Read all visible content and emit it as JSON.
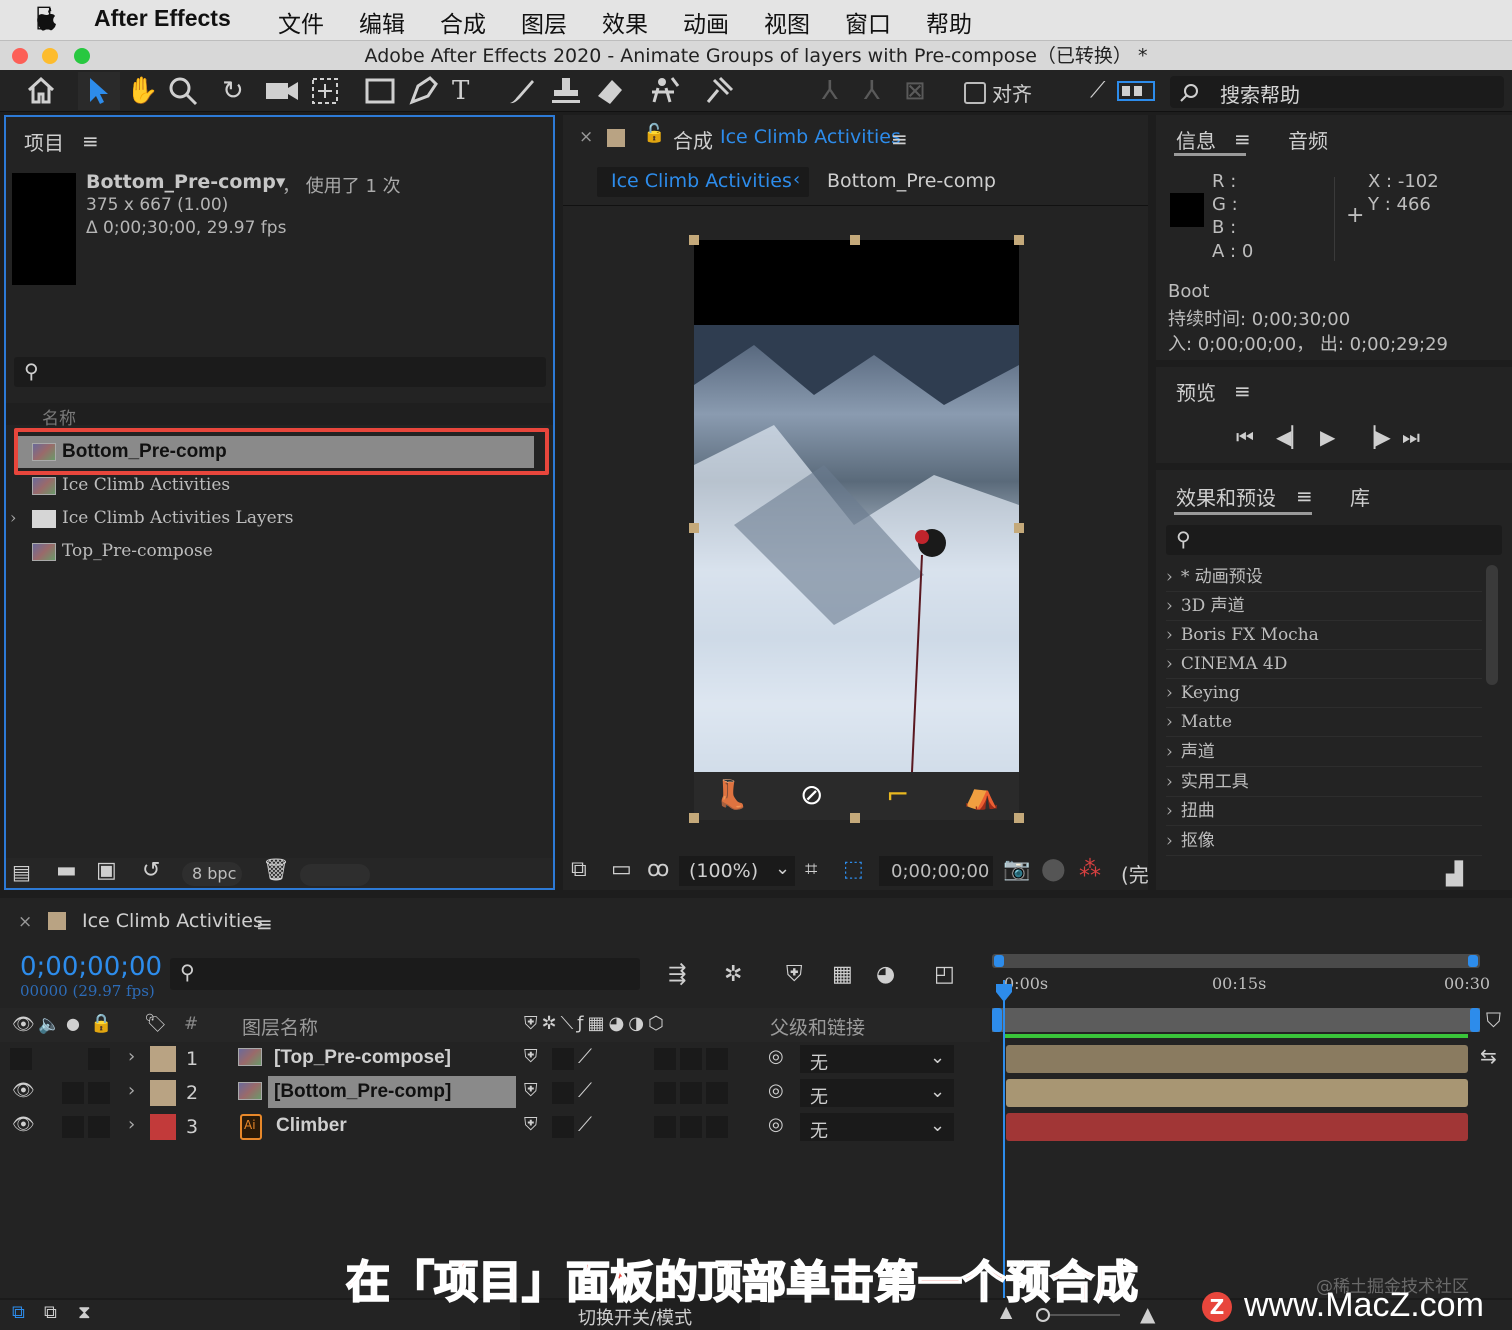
{
  "menubar": {
    "apple": "",
    "app_name": "After Effects",
    "items": [
      "文件",
      "编辑",
      "合成",
      "图层",
      "效果",
      "动画",
      "视图",
      "窗口",
      "帮助"
    ]
  },
  "window": {
    "title": "Adobe After Effects 2020 - Animate Groups of layers with Pre-compose（已转换） *"
  },
  "toolbar": {
    "align_label": "对齐",
    "search_help": "搜索帮助"
  },
  "project_panel": {
    "title": "项目",
    "selected_name": "Bottom_Pre-comp▾",
    "used_count": "，  使用了 1 次",
    "dimensions": "375 x 667 (1.00)",
    "duration": "Δ 0;00;30;00, 29.97 fps",
    "column_name": "名称",
    "items": [
      {
        "name": "Bottom_Pre-comp",
        "type": "comp",
        "selected": true
      },
      {
        "name": "Ice Climb Activities",
        "type": "comp"
      },
      {
        "name": "Ice Climb Activities Layers",
        "type": "folder"
      },
      {
        "name": "Top_Pre-compose",
        "type": "comp"
      }
    ],
    "bpc": "8 bpc"
  },
  "comp_panel": {
    "title_prefix": "合成",
    "title_name": "Ice Climb Activities",
    "tab_active": "Ice Climb Activities",
    "tab_other": "Bottom_Pre-comp",
    "zoom": "(100%)",
    "timecode": "0;00;00;00",
    "quality": "(完"
  },
  "info_panel": {
    "tab_info": "信息",
    "tab_audio": "音频",
    "r": "R :",
    "g": "G :",
    "b": "B :",
    "a": "A :  0",
    "x": "X : -102",
    "y": "Y :  466",
    "layer_name": "Boot",
    "duration": "持续时间: 0;00;30;00",
    "in_out": "入: 0;00;00;00，  出: 0;00;29;29"
  },
  "preview_panel": {
    "title": "预览"
  },
  "effects_panel": {
    "title": "效果和预设",
    "tab_library": "库",
    "items": [
      "* 动画预设",
      "3D 声道",
      "Boris FX Mocha",
      "CINEMA 4D",
      "Keying",
      "Matte",
      "声道",
      "实用工具",
      "扭曲",
      "抠像"
    ]
  },
  "timeline": {
    "title": "Ice Climb Activities",
    "timecode": "0;00;00;00",
    "frame_info": "00000 (29.97 fps)",
    "col_layer_name": "图层名称",
    "col_parent": "父级和链接",
    "col_num": "#",
    "ruler": [
      "0:00s",
      "00:15s",
      "00:30"
    ],
    "layers": [
      {
        "num": "1",
        "name": "[Top_Pre-compose]",
        "label_color": "#b9a383",
        "parent": "无",
        "bar_color": "#8a7b60",
        "visible": false
      },
      {
        "num": "2",
        "name": "[Bottom_Pre-comp]",
        "label_color": "#b9a383",
        "parent": "无",
        "bar_color": "#a89673",
        "visible": true
      },
      {
        "num": "3",
        "name": "Climber",
        "label_color": "#c23a3a",
        "parent": "无",
        "bar_color": "#a13636",
        "visible": true,
        "ai": "Ai"
      }
    ],
    "toggle_label": "切换开关/模式"
  },
  "overlay": {
    "subtitle": "在「项目」面板的顶部单击第一个预合成",
    "watermark_small": "@稀土掘金技术社区",
    "watermark_big": "www.MacZ.com",
    "watermark_logo": "Z"
  },
  "colors": {
    "accent_blue": "#2d8ceb",
    "highlight_red": "#e8463c",
    "work_area_green": "#3ac43a"
  }
}
